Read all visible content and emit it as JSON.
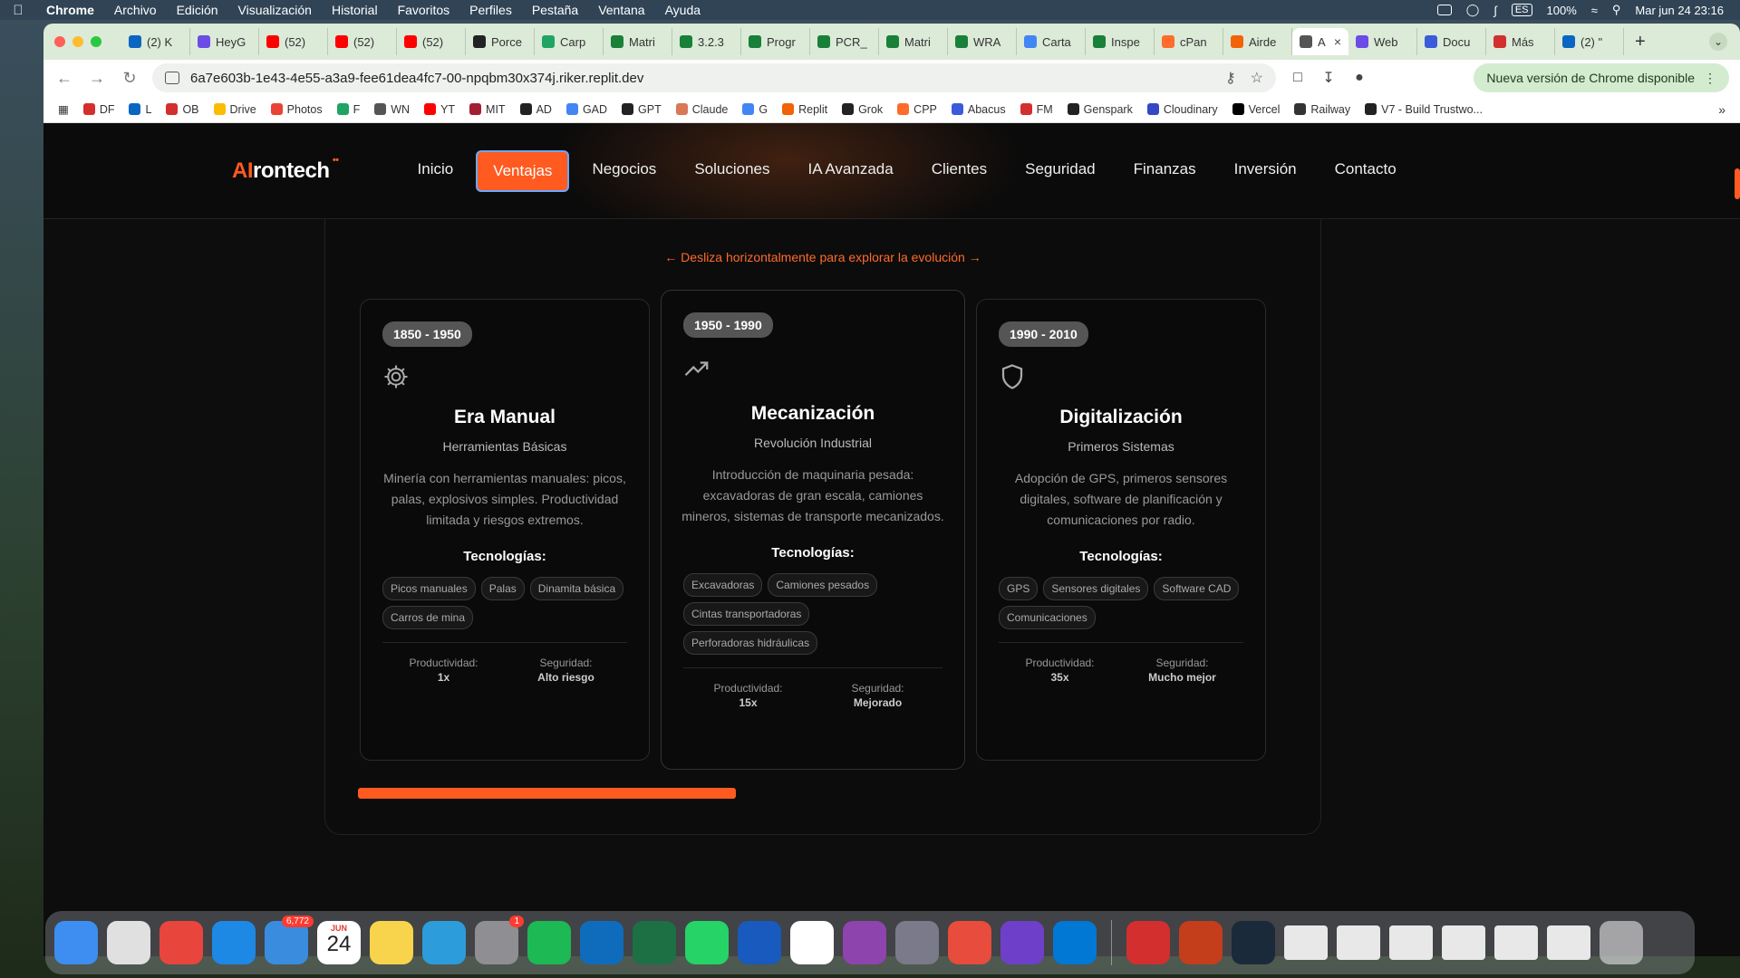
{
  "menubar": {
    "app": "Chrome",
    "items": [
      "Archivo",
      "Edición",
      "Visualización",
      "Historial",
      "Favoritos",
      "Perfiles",
      "Pestaña",
      "Ventana",
      "Ayuda"
    ],
    "lang": "ES",
    "battery": "100%",
    "clock": "Mar jun 24  23:16"
  },
  "tabs": [
    {
      "label": "(2) K",
      "color": "#0a66c2"
    },
    {
      "label": "HeyG",
      "color": "#6b4ce6"
    },
    {
      "label": "(52)",
      "color": "#ff0000"
    },
    {
      "label": "(52)",
      "color": "#ff0000"
    },
    {
      "label": "(52)",
      "color": "#ff0000"
    },
    {
      "label": "Porce",
      "color": "#222222"
    },
    {
      "label": "Carp",
      "color": "#1fa463"
    },
    {
      "label": "Matri",
      "color": "#188038"
    },
    {
      "label": "3.2.3",
      "color": "#188038"
    },
    {
      "label": "Progr",
      "color": "#188038"
    },
    {
      "label": "PCR_",
      "color": "#188038"
    },
    {
      "label": "Matri",
      "color": "#188038"
    },
    {
      "label": "WRA",
      "color": "#188038"
    },
    {
      "label": "Carta",
      "color": "#4285f4"
    },
    {
      "label": "Inspe",
      "color": "#188038"
    },
    {
      "label": "cPan",
      "color": "#ff6c2c"
    },
    {
      "label": "Airde",
      "color": "#f26207"
    },
    {
      "label": "A",
      "color": "#555555",
      "active": true
    },
    {
      "label": "Web",
      "color": "#6b4ce6"
    },
    {
      "label": "Docu",
      "color": "#3b5bdb"
    },
    {
      "label": "Más",
      "color": "#d32f2f"
    },
    {
      "label": "(2) \"",
      "color": "#0a66c2"
    }
  ],
  "toolbar": {
    "url": "6a7e603b-1e43-4e55-a3a9-fee61dea4fc7-00-npqbm30x374j.riker.replit.dev",
    "update_label": "Nueva versión de Chrome disponible"
  },
  "bookmarks": [
    {
      "label": "DF",
      "color": "#d32f2f"
    },
    {
      "label": "L",
      "color": "#0a66c2"
    },
    {
      "label": "OB",
      "color": "#d32f2f"
    },
    {
      "label": "Drive",
      "color": "#fbbc04"
    },
    {
      "label": "Photos",
      "color": "#ea4335"
    },
    {
      "label": "F",
      "color": "#1fa463"
    },
    {
      "label": "WN",
      "color": "#555555"
    },
    {
      "label": "YT",
      "color": "#ff0000"
    },
    {
      "label": "MIT",
      "color": "#a31f34"
    },
    {
      "label": "AD",
      "color": "#222222"
    },
    {
      "label": "GAD",
      "color": "#4285f4"
    },
    {
      "label": "GPT",
      "color": "#222222"
    },
    {
      "label": "Claude",
      "color": "#d97757"
    },
    {
      "label": "G",
      "color": "#4285f4"
    },
    {
      "label": "Replit",
      "color": "#f26207"
    },
    {
      "label": "Grok",
      "color": "#222222"
    },
    {
      "label": "CPP",
      "color": "#ff6c2c"
    },
    {
      "label": "Abacus",
      "color": "#3b5bdb"
    },
    {
      "label": "FM",
      "color": "#d32f2f"
    },
    {
      "label": "Genspark",
      "color": "#222222"
    },
    {
      "label": "Cloudinary",
      "color": "#3448c5"
    },
    {
      "label": "Vercel",
      "color": "#000000"
    },
    {
      "label": "Railway",
      "color": "#333333"
    },
    {
      "label": "V7 - Build Trustwo...",
      "color": "#222222"
    }
  ],
  "site": {
    "logo_ai": "AI",
    "logo_rest": "rontech",
    "nav": [
      "Inicio",
      "Ventajas",
      "Negocios",
      "Soluciones",
      "IA Avanzada",
      "Clientes",
      "Seguridad",
      "Finanzas",
      "Inversión",
      "Contacto"
    ],
    "active_nav": "Ventajas",
    "hint": "← Desliza horizontalmente para explorar la evolución →",
    "accent": "#ff5a1f"
  },
  "cards": [
    {
      "period": "1850 - 1950",
      "icon": "gear-icon",
      "title": "Era Manual",
      "subtitle": "Herramientas Básicas",
      "description": "Minería con herramientas manuales: picos, palas, explosivos simples. Productividad limitada y riesgos extremos.",
      "tech_heading": "Tecnologías:",
      "tags": [
        "Picos manuales",
        "Palas",
        "Dinamita básica",
        "Carros de mina"
      ],
      "stats": [
        {
          "label": "Productividad:",
          "value": "1x"
        },
        {
          "label": "Seguridad:",
          "value": "Alto riesgo"
        }
      ]
    },
    {
      "period": "1950 - 1990",
      "icon": "trending-up-icon",
      "title": "Mecanización",
      "subtitle": "Revolución Industrial",
      "description": "Introducción de maquinaria pesada: excavadoras de gran escala, camiones mineros, sistemas de transporte mecanizados.",
      "tech_heading": "Tecnologías:",
      "tags": [
        "Excavadoras",
        "Camiones pesados",
        "Cintas transportadoras",
        "Perforadoras hidráulicas"
      ],
      "stats": [
        {
          "label": "Productividad:",
          "value": "15x"
        },
        {
          "label": "Seguridad:",
          "value": "Mejorado"
        }
      ]
    },
    {
      "period": "1990 - 2010",
      "icon": "shield-icon",
      "title": "Digitalización",
      "subtitle": "Primeros Sistemas",
      "description": "Adopción de GPS, primeros sensores digitales, software de planificación y comunicaciones por radio.",
      "tech_heading": "Tecnologías:",
      "tags": [
        "GPS",
        "Sensores digitales",
        "Software CAD",
        "Comunicaciones"
      ],
      "stats": [
        {
          "label": "Productividad:",
          "value": "35x"
        },
        {
          "label": "Seguridad:",
          "value": "Mucho mejor"
        }
      ]
    }
  ],
  "scroll_progress": 0.405,
  "dock": {
    "mail_badge": "6,772",
    "settings_badge": "1",
    "calendar_month": "JUN",
    "calendar_day": "24",
    "apps": [
      {
        "name": "finder-icon",
        "color": "#3d8ef0"
      },
      {
        "name": "launchpad-icon",
        "color": "#e0e0e0"
      },
      {
        "name": "chrome-icon",
        "color": "#e8453c"
      },
      {
        "name": "safari-icon",
        "color": "#1e88e5"
      },
      {
        "name": "mail-icon",
        "color": "#3a8dde"
      },
      {
        "name": "calendar-icon",
        "color": "#ffffff"
      },
      {
        "name": "notes-icon",
        "color": "#f8d44c"
      },
      {
        "name": "keynote-icon",
        "color": "#2d9cdb"
      },
      {
        "name": "system-settings-icon",
        "color": "#8e8e93"
      },
      {
        "name": "spotify-icon",
        "color": "#1db954"
      },
      {
        "name": "outlook-icon",
        "color": "#0f6cbd"
      },
      {
        "name": "excel-icon",
        "color": "#1d7044"
      },
      {
        "name": "whatsapp-icon",
        "color": "#25d366"
      },
      {
        "name": "word-icon",
        "color": "#185abd"
      },
      {
        "name": "calendar31-icon",
        "color": "#ffffff"
      },
      {
        "name": "circle-app-icon",
        "color": "#8e44ad"
      },
      {
        "name": "phone-mirror-icon",
        "color": "#7a7a8a"
      },
      {
        "name": "pieces-icon",
        "color": "#e74c3c"
      },
      {
        "name": "github-icon",
        "color": "#6e40c9"
      },
      {
        "name": "vscode-icon",
        "color": "#0078d4"
      },
      {
        "name": "acrobat-icon",
        "color": "#d32f2f"
      },
      {
        "name": "powerpoint-icon",
        "color": "#c43e1c"
      },
      {
        "name": "quicktime-icon",
        "color": "#1b2a3a"
      }
    ]
  }
}
